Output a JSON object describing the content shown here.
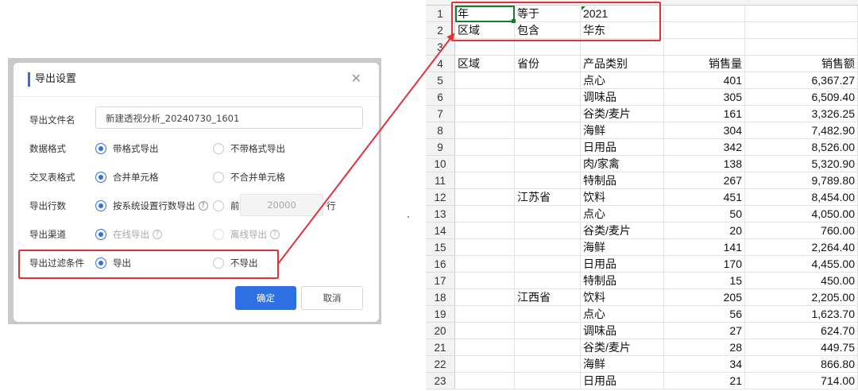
{
  "dialog": {
    "title": "导出设置",
    "close_symbol": "✕",
    "rows": {
      "filename": {
        "label": "导出文件名",
        "value": "新建透视分析_20240730_1601"
      },
      "data_format": {
        "label": "数据格式",
        "opt1": "带格式导出",
        "opt2": "不带格式导出"
      },
      "cross_table": {
        "label": "交叉表格式",
        "opt1": "合并单元格",
        "opt2": "不合并单元格"
      },
      "row_count": {
        "label": "导出行数",
        "opt1": "按系统设置行数导出",
        "opt2_prefix": "前",
        "opt2_value": "20000",
        "opt2_suffix": "行"
      },
      "channel": {
        "label": "导出渠道",
        "opt1": "在线导出",
        "opt2": "离线导出"
      },
      "filter": {
        "label": "导出过滤条件",
        "opt1": "导出",
        "opt2": "不导出"
      }
    },
    "help_symbol": "?",
    "confirm_label": "确定",
    "cancel_label": "取消"
  },
  "sheet": {
    "rows": [
      {
        "n": "1",
        "a": "年",
        "b": "等于",
        "c": "2021",
        "d": "",
        "e": ""
      },
      {
        "n": "2",
        "a": "区域",
        "b": "包含",
        "c": "华东",
        "d": "",
        "e": ""
      },
      {
        "n": "3",
        "a": "",
        "b": "",
        "c": "",
        "d": "",
        "e": ""
      },
      {
        "n": "4",
        "a": "区域",
        "b": "省份",
        "c": "产品类别",
        "d": "销售量",
        "e": "销售额"
      },
      {
        "n": "5",
        "a": "",
        "b": "",
        "c": "点心",
        "d": "401",
        "e": "6,367.27"
      },
      {
        "n": "6",
        "a": "",
        "b": "",
        "c": "调味品",
        "d": "305",
        "e": "6,509.40"
      },
      {
        "n": "7",
        "a": "",
        "b": "",
        "c": "谷类/麦片",
        "d": "161",
        "e": "3,326.25"
      },
      {
        "n": "8",
        "a": "",
        "b": "",
        "c": "海鲜",
        "d": "304",
        "e": "7,482.90"
      },
      {
        "n": "9",
        "a": "",
        "b": "",
        "c": "日用品",
        "d": "342",
        "e": "8,526.00"
      },
      {
        "n": "10",
        "a": "",
        "b": "",
        "c": "肉/家禽",
        "d": "138",
        "e": "5,320.90"
      },
      {
        "n": "11",
        "a": "",
        "b": "",
        "c": "特制品",
        "d": "267",
        "e": "9,789.80"
      },
      {
        "n": "12",
        "a": "",
        "b": "江苏省",
        "c": "饮料",
        "d": "451",
        "e": "8,454.00"
      },
      {
        "n": "13",
        "a": "",
        "b": "",
        "c": "点心",
        "d": "50",
        "e": "4,050.00"
      },
      {
        "n": "14",
        "a": "",
        "b": "",
        "c": "谷类/麦片",
        "d": "20",
        "e": "760.00"
      },
      {
        "n": "15",
        "a": "",
        "b": "",
        "c": "海鲜",
        "d": "141",
        "e": "2,264.40"
      },
      {
        "n": "16",
        "a": "",
        "b": "",
        "c": "日用品",
        "d": "170",
        "e": "4,455.00"
      },
      {
        "n": "17",
        "a": "",
        "b": "",
        "c": "特制品",
        "d": "15",
        "e": "450.00"
      },
      {
        "n": "18",
        "a": "",
        "b": "江西省",
        "c": "饮料",
        "d": "205",
        "e": "2,205.00"
      },
      {
        "n": "19",
        "a": "",
        "b": "",
        "c": "点心",
        "d": "56",
        "e": "1,623.70"
      },
      {
        "n": "20",
        "a": "",
        "b": "",
        "c": "调味品",
        "d": "27",
        "e": "624.70"
      },
      {
        "n": "21",
        "a": "",
        "b": "",
        "c": "谷类/麦片",
        "d": "28",
        "e": "449.75"
      },
      {
        "n": "22",
        "a": "",
        "b": "",
        "c": "海鲜",
        "d": "34",
        "e": "866.80"
      },
      {
        "n": "23",
        "a": "",
        "b": "",
        "c": "日用品",
        "d": "21",
        "e": "714.00"
      }
    ]
  },
  "colors": {
    "accent": "#2f6fe4",
    "highlight": "#e1323a",
    "selection": "#1e7a32"
  }
}
